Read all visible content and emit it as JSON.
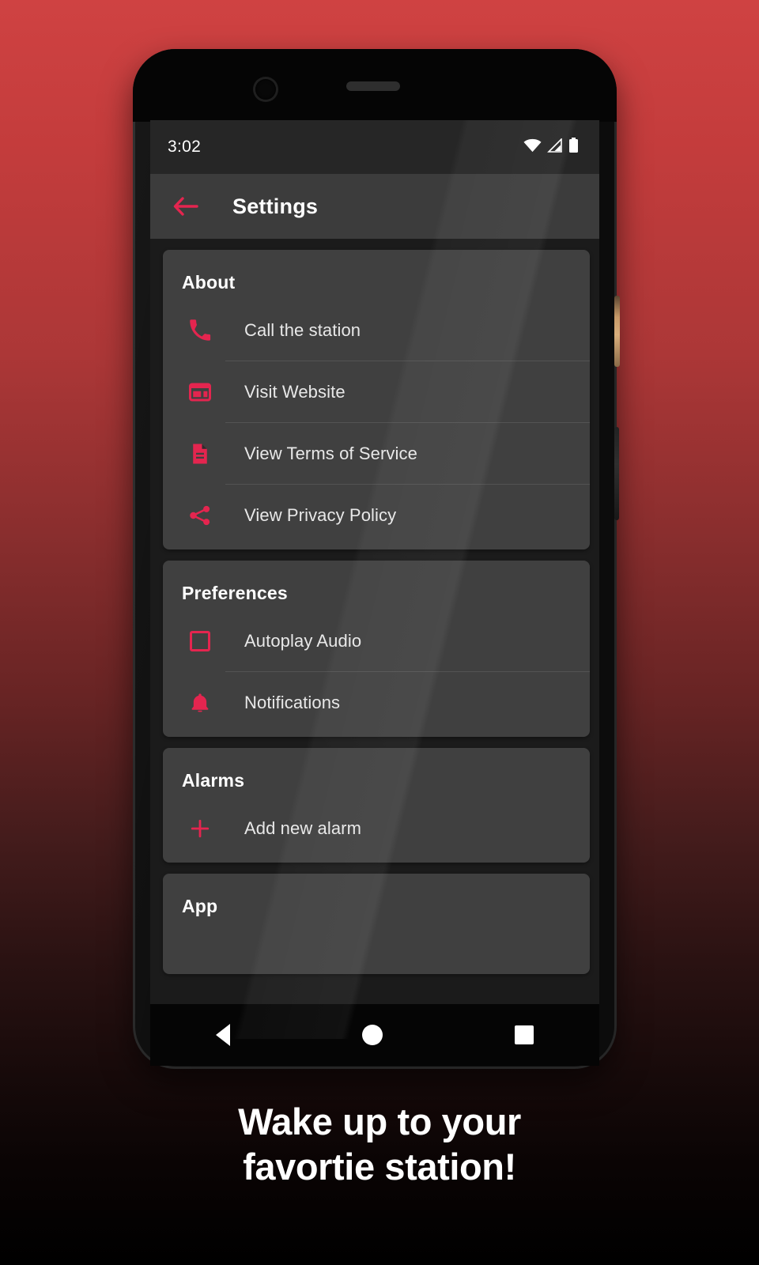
{
  "theme": {
    "accent": "#e4254f",
    "card_bg": "#404040",
    "screen_bg": "#1b1b1b",
    "app_bar_bg": "#3c3c3c",
    "bg_gradient_top": "#cf4242",
    "bg_gradient_bottom": "#000000"
  },
  "status_bar": {
    "time": "3:02",
    "icons": [
      "wifi-icon",
      "cellular-signal-icon",
      "battery-icon"
    ]
  },
  "app_bar": {
    "back_icon": "back-arrow-icon",
    "title": "Settings"
  },
  "cards": [
    {
      "title": "About",
      "rows": [
        {
          "icon": "phone-icon",
          "label": "Call the station"
        },
        {
          "icon": "website-icon",
          "label": "Visit Website"
        },
        {
          "icon": "document-icon",
          "label": "View Terms of Service"
        },
        {
          "icon": "share-icon",
          "label": "View Privacy Policy"
        }
      ]
    },
    {
      "title": "Preferences",
      "rows": [
        {
          "icon": "checkbox-unchecked-icon",
          "label": "Autoplay Audio"
        },
        {
          "icon": "bell-icon",
          "label": "Notifications"
        }
      ]
    },
    {
      "title": "Alarms",
      "rows": [
        {
          "icon": "plus-icon",
          "label": "Add new alarm"
        }
      ]
    },
    {
      "title": "App",
      "rows": []
    }
  ],
  "nav_bar": {
    "back": "nav-back-icon",
    "home": "nav-home-icon",
    "recents": "nav-recents-icon"
  },
  "caption": {
    "line1": "Wake up to your",
    "line2": "favortie station!"
  }
}
